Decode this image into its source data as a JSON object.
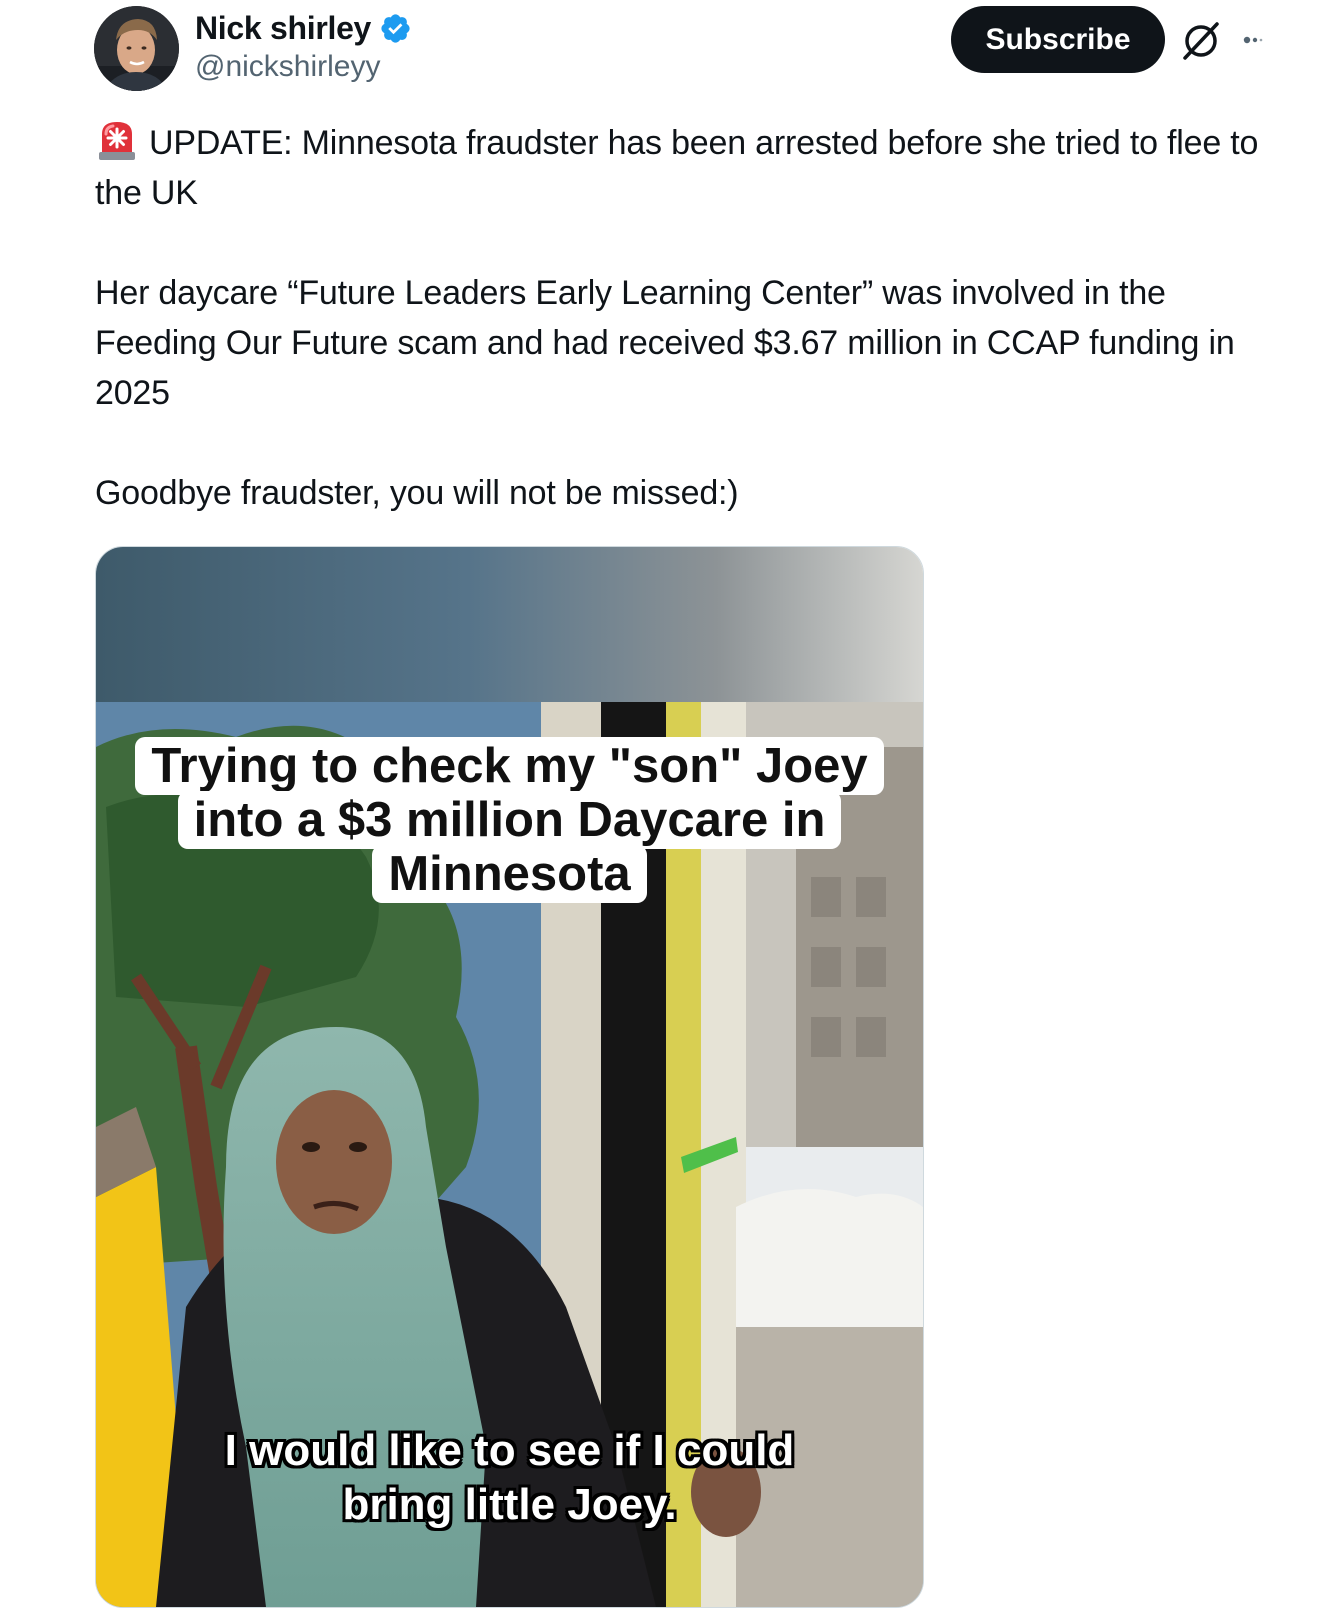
{
  "author": {
    "display_name": "Nick shirley",
    "handle": "@nickshirleyy",
    "avatar_icon": "profile-photo",
    "verified_icon": "verified-badge-icon",
    "verified_color": "#1d9bf0"
  },
  "header": {
    "subscribe_label": "Subscribe",
    "grok_icon": "grok-icon",
    "more_icon": "more-options-icon"
  },
  "tweet": {
    "emoji_icon": "police-siren-icon",
    "paragraph_1": "UPDATE: Minnesota fraudster has been arrested before she tried to flee to the UK",
    "paragraph_2": "Her daycare “Future Leaders Early Learning Center” was involved in the Feeding Our Future scam and had received $3.67 million in CCAP funding in 2025",
    "paragraph_3": "Goodbye fraudster, you will not be missed:)"
  },
  "media": {
    "caption_top_line_1": "Trying to check my \"son\" Joey",
    "caption_top_line_2": "into a $3 million Daycare in",
    "caption_top_line_3": "Minnesota",
    "caption_bottom_line_1": "I would like to see if I could",
    "caption_bottom_line_2": "bring little Joey."
  },
  "colors": {
    "text_primary": "#0f1419",
    "text_secondary": "#536471",
    "button_bg": "#0f1419",
    "button_text": "#ffffff"
  }
}
